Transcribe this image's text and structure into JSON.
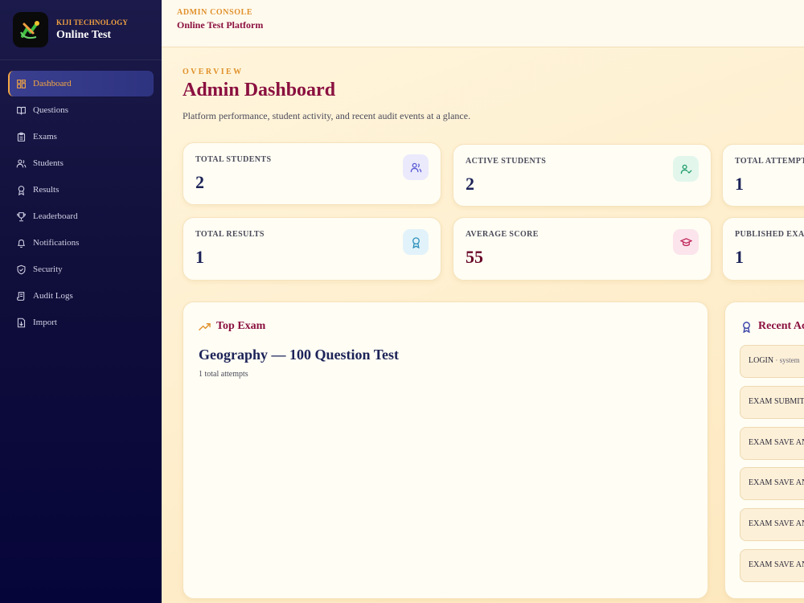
{
  "brand": {
    "kicker": "KIJI TECHNOLOGY",
    "title": "Online Test"
  },
  "sidebar": {
    "items": [
      {
        "label": "Dashboard",
        "icon": "dashboard-icon",
        "active": true
      },
      {
        "label": "Questions",
        "icon": "book-icon"
      },
      {
        "label": "Exams",
        "icon": "clipboard-icon"
      },
      {
        "label": "Students",
        "icon": "users-icon"
      },
      {
        "label": "Results",
        "icon": "award-icon"
      },
      {
        "label": "Leaderboard",
        "icon": "trophy-icon"
      },
      {
        "label": "Notifications",
        "icon": "bell-icon"
      },
      {
        "label": "Security",
        "icon": "shield-icon"
      },
      {
        "label": "Audit Logs",
        "icon": "scroll-icon"
      },
      {
        "label": "Import",
        "icon": "file-import-icon"
      }
    ]
  },
  "topbar": {
    "kicker": "ADMIN CONSOLE",
    "title": "Online Test Platform"
  },
  "page": {
    "kicker": "OVERVIEW",
    "title": "Admin Dashboard",
    "subtitle": "Platform performance, student activity, and recent audit events at a glance."
  },
  "stats": [
    {
      "label": "TOTAL STUDENTS",
      "value": "2",
      "icon": "users-icon",
      "color": "#5b5bd6"
    },
    {
      "label": "ACTIVE STUDENTS",
      "value": "2",
      "icon": "user-check-icon",
      "color": "#1f9d6a"
    },
    {
      "label": "TOTAL ATTEMPTS",
      "value": "1"
    },
    {
      "label": "TOTAL RESULTS",
      "value": "1",
      "icon": "award-icon",
      "color": "#2a8fb8"
    },
    {
      "label": "AVERAGE SCORE",
      "value": "55",
      "icon": "graduation-cap-icon",
      "color": "#c0265a"
    },
    {
      "label": "PUBLISHED EXAMS",
      "value": "1"
    }
  ],
  "top_exam": {
    "title": "Top Exam",
    "icon": "trending-up-icon",
    "exam_name": "Geography — 100 Question Test",
    "attempts": "1 total attempts"
  },
  "recent_activity": {
    "title": "Recent Activity",
    "icon": "award-icon",
    "items": [
      {
        "action": "LOGIN",
        "meta": " · system"
      },
      {
        "action": "EXAM SUBMIT",
        "meta": ""
      },
      {
        "action": "EXAM SAVE ANSWER",
        "meta": ""
      },
      {
        "action": "EXAM SAVE ANSWER",
        "meta": ""
      },
      {
        "action": "EXAM SAVE ANSWER",
        "meta": ""
      },
      {
        "action": "EXAM SAVE ANSWER",
        "meta": ""
      }
    ]
  }
}
